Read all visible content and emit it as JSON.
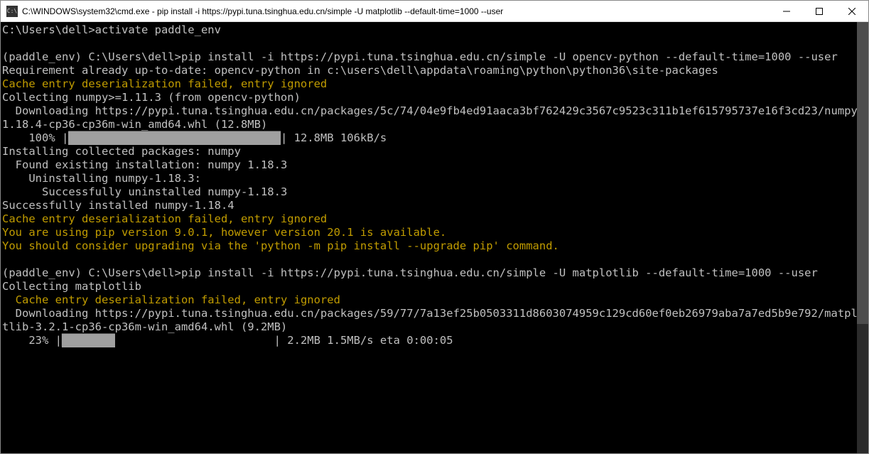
{
  "titlebar": {
    "icon_label": "C:\\",
    "title": "C:\\WINDOWS\\system32\\cmd.exe - pip  install -i https://pypi.tuna.tsinghua.edu.cn/simple -U matplotlib --default-time=1000 --user"
  },
  "terminal": {
    "line1_prompt": "C:\\Users\\dell>",
    "line1_cmd": "activate paddle_env",
    "line2_blank": "",
    "line3": "(paddle_env) C:\\Users\\dell>pip install -i https://pypi.tuna.tsinghua.edu.cn/simple -U opencv-python --default-time=1000 --user",
    "line4": "Requirement already up-to-date: opencv-python in c:\\users\\dell\\appdata\\roaming\\python\\python36\\site-packages",
    "line5_warn": "Cache entry deserialization failed, entry ignored",
    "line6": "Collecting numpy>=1.11.3 (from opencv-python)",
    "line7": "  Downloading https://pypi.tuna.tsinghua.edu.cn/packages/5c/74/04e9fb4ed91aaca3bf762429c3567c9523c311b1ef615795737e16f3cd23/numpy-1.18.4-cp36-cp36m-win_amd64.whl (12.8MB)",
    "line8_pct": "    100% |",
    "line8_bar": "████████████████████████████████",
    "line8_tail": "| 12.8MB 106kB/s",
    "line9": "Installing collected packages: numpy",
    "line10": "  Found existing installation: numpy 1.18.3",
    "line11": "    Uninstalling numpy-1.18.3:",
    "line12": "      Successfully uninstalled numpy-1.18.3",
    "line13": "Successfully installed numpy-1.18.4",
    "line14_warn": "Cache entry deserialization failed, entry ignored",
    "line15_warn": "You are using pip version 9.0.1, however version 20.1 is available.",
    "line16_warn": "You should consider upgrading via the 'python -m pip install --upgrade pip' command.",
    "line17_blank": "",
    "line18": "(paddle_env) C:\\Users\\dell>pip install -i https://pypi.tuna.tsinghua.edu.cn/simple -U matplotlib --default-time=1000 --user",
    "line19": "Collecting matplotlib",
    "line20_warn": "  Cache entry deserialization failed, entry ignored",
    "line21": "  Downloading https://pypi.tuna.tsinghua.edu.cn/packages/59/77/7a13ef25b0503311d8603074959c129cd60ef0eb26979aba7a7ed5b9e792/matplotlib-3.2.1-cp36-cp36m-win_amd64.whl (9.2MB)",
    "line22_pct": "    23% |",
    "line22_bar": "████████",
    "line22_space": "                        ",
    "line22_tail": "| 2.2MB 1.5MB/s eta 0:00:05"
  }
}
